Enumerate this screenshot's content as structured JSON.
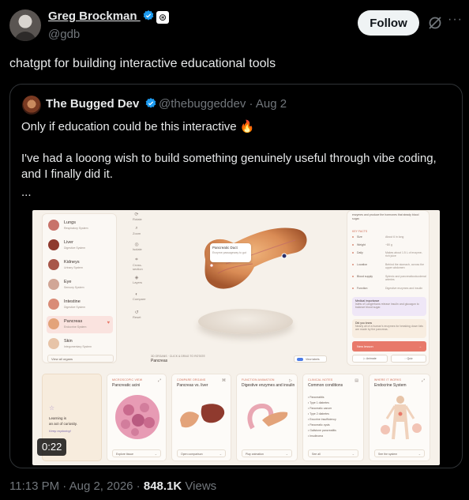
{
  "author": {
    "name": "Greg Brockman",
    "handle": "@gdb",
    "follow_label": "Follow",
    "affiliate_badge": "openai-logo-icon"
  },
  "tweet": {
    "text": "chatgpt for building interactive educational tools"
  },
  "quoted": {
    "name": "The Bugged Dev",
    "handle": "@thebuggeddev",
    "date": "Aug 2",
    "line1": "Only if education could be this interactive",
    "line1_emoji": "🔥",
    "line2": "I've had a looong wish to build something genuinely useful through vibe coding, and I finally did it.",
    "line3": "...",
    "video": {
      "duration": "0:22",
      "sidebar_items": [
        {
          "label": "Lungs",
          "sub": "Respiratory System",
          "color": "#c8736a"
        },
        {
          "label": "Liver",
          "sub": "Digestive System",
          "color": "#8f3a2e"
        },
        {
          "label": "Kidneys",
          "sub": "Urinary System",
          "color": "#a8574a"
        },
        {
          "label": "Eye",
          "sub": "Sensory System",
          "color": "#d1a696"
        },
        {
          "label": "Intestine",
          "sub": "Digestive System",
          "color": "#d98c77"
        },
        {
          "label": "Pancreas",
          "sub": "Endocrine System",
          "color": "#e3a37a"
        },
        {
          "label": "Skin",
          "sub": "Integumentary System",
          "color": "#e7c4a8"
        }
      ],
      "sidebar_footer": "View all organs",
      "tools": [
        "Rotate",
        "Zoom",
        "Isolate",
        "Cross-section",
        "Layers",
        "Compare",
        "Reset"
      ],
      "tooltip_title": "Pancreatic Duct",
      "tooltip_sub": "Enzyme passageway to gut",
      "center_label": "3D ORGANS · CLICK & DRAG TO ROTATE",
      "center_name": "Pancreas",
      "view_toggle": "View labels",
      "right_header": "enzymes and produce the hormones that steady blood sugar.",
      "facts_heading": "KEY FACTS",
      "facts": [
        {
          "k": "Size",
          "v": "About 6 in long"
        },
        {
          "k": "Weight",
          "v": "~80 g"
        },
        {
          "k": "Daily",
          "v": "Makes about 1.5 L of enzyme-rich juice"
        },
        {
          "k": "Location",
          "v": "Behind the stomach, across the upper abdomen"
        },
        {
          "k": "Blood supply",
          "v": "Splenic and pancreaticoduodenal arteries"
        },
        {
          "k": "Function",
          "v": "Digestive enzymes and insulin"
        }
      ],
      "callout1_title": "Medical importance",
      "callout1_text": "Islets of Langerhans release insulin and glucagon to balance blood sugar.",
      "callout2_title": "Did you know",
      "callout2_text": "Nearly all of a human's enzymes for breaking down fats are made by the pancreas.",
      "learn_btn": "New lesson",
      "mini_btn1": "Animate",
      "mini_btn2": "Quiz",
      "first_card_text1": "Learning is",
      "first_card_text2": "an act of curiosity.",
      "first_card_text3": "Keep exploring!",
      "cards": [
        {
          "tag": "MICROSCOPIC VIEW",
          "title": "Pancreatic acini",
          "foot": "Explore tissue"
        },
        {
          "tag": "COMPARE ORGANS",
          "title": "Pancreas vs. liver",
          "foot": "Open comparison"
        },
        {
          "tag": "FUNCTION ANIMATION",
          "title": "Digestive enzymes and insulin",
          "foot": "Play animation"
        },
        {
          "tag": "CLINICAL NOTES",
          "title": "Common conditions",
          "foot": "See all",
          "list": [
            "Pancreatitis",
            "Type 1 diabetes",
            "Pancreatic cancer",
            "Type 2 diabetes",
            "Exocrine insufficiency",
            "Pancreatic cysts",
            "Gallstone pancreatitis",
            "Insulinoma"
          ]
        },
        {
          "tag": "WHERE IT WORKS",
          "title": "Endocrine System",
          "foot": "See the system"
        }
      ]
    }
  },
  "meta": {
    "time": "11:13 PM",
    "date": "Aug 2, 2026",
    "views_count": "848.1K",
    "views_label": "Views"
  },
  "colors": {
    "background": "#000000",
    "text": "#e7e9ea",
    "muted": "#71767b",
    "verified": "#1d9bf0",
    "border": "#2f3336"
  }
}
